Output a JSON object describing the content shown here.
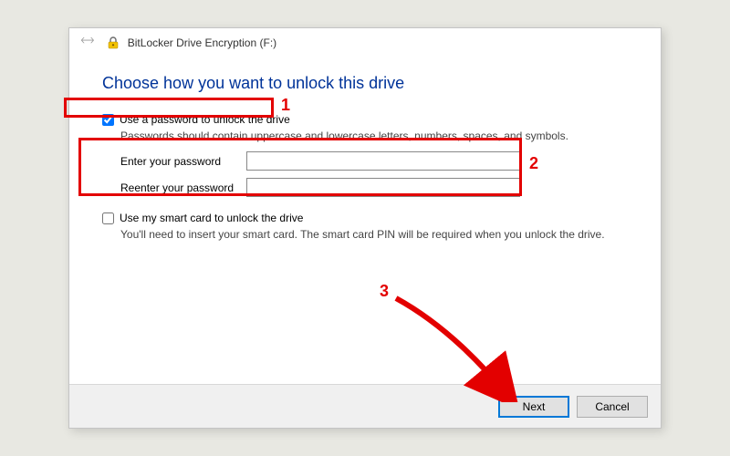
{
  "window": {
    "title": "BitLocker Drive Encryption (F:)",
    "icon_name": "bitlocker-icon"
  },
  "heading": "Choose how you want to unlock this drive",
  "password_option": {
    "checkbox_label": "Use a password to unlock the drive",
    "help": "Passwords should contain uppercase and lowercase letters, numbers, spaces, and symbols.",
    "enter_label": "Enter your password",
    "reenter_label": "Reenter your password",
    "enter_value": "",
    "reenter_value": ""
  },
  "smartcard_option": {
    "checkbox_label": "Use my smart card to unlock the drive",
    "help": "You'll need to insert your smart card. The smart card PIN will be required when you unlock the drive."
  },
  "buttons": {
    "next": "Next",
    "cancel": "Cancel"
  },
  "annotations": {
    "n1": "1",
    "n2": "2",
    "n3": "3"
  }
}
